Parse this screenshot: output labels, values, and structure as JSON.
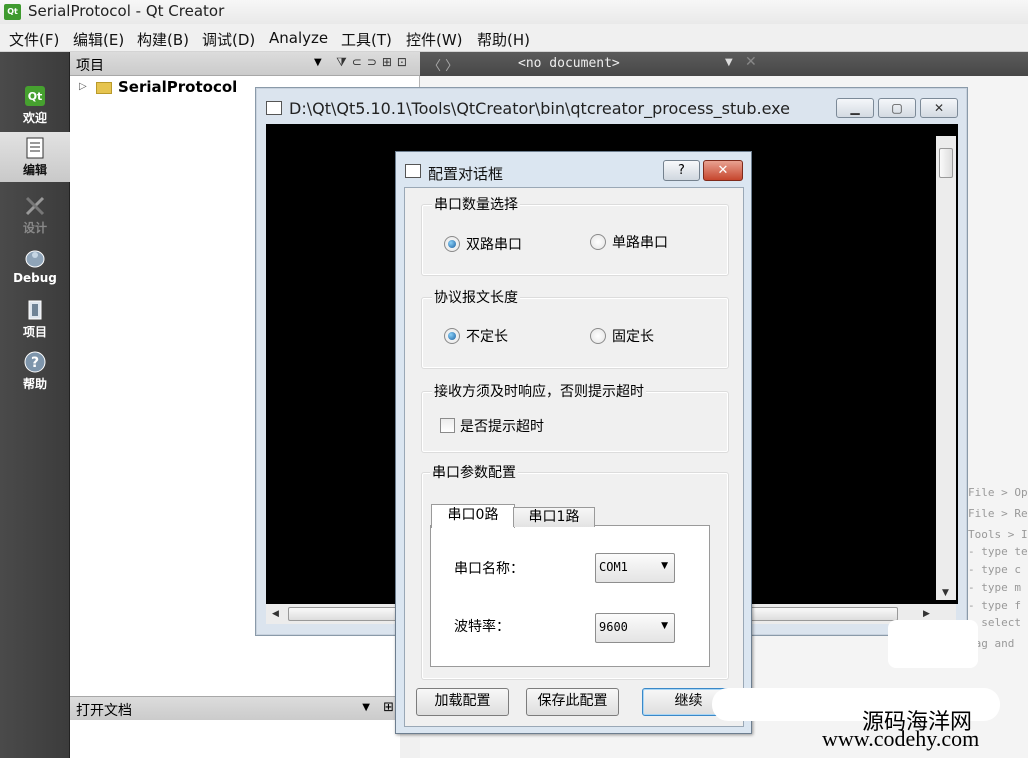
{
  "window": {
    "title": "SerialProtocol - Qt Creator",
    "logo_text": "Qt"
  },
  "menu": [
    "文件(F)",
    "编辑(E)",
    "构建(B)",
    "调试(D)",
    "Analyze",
    "工具(T)",
    "控件(W)",
    "帮助(H)"
  ],
  "modes": [
    {
      "label": "欢迎",
      "icon": "qt-logo-icon"
    },
    {
      "label": "编辑",
      "icon": "edit-document-icon"
    },
    {
      "label": "设计",
      "icon": "design-tools-icon"
    },
    {
      "label": "Debug",
      "icon": "debug-bug-icon"
    },
    {
      "label": "项目",
      "icon": "project-icon"
    },
    {
      "label": "帮助",
      "icon": "help-icon"
    }
  ],
  "projects": {
    "header": "项目",
    "tree_root": "SerialProtocol"
  },
  "open_docs": {
    "header": "打开文档"
  },
  "editor": {
    "doc_selector": "<no document>",
    "hints": [
      "File > Op",
      "File > Re",
      "Tools > I",
      "- type te",
      "- type c",
      "- type m",
      "- type f",
      "- select",
      "rag and"
    ]
  },
  "console": {
    "title": "D:\\Qt\\Qt5.10.1\\Tools\\QtCreator\\bin\\qtcreator_process_stub.exe"
  },
  "dialog": {
    "title": "配置对话框",
    "help_symbol": "?",
    "close_symbol": "✕",
    "group_count": {
      "title": "串口数量选择",
      "options": [
        {
          "label": "双路串口",
          "checked": true
        },
        {
          "label": "单路串口",
          "checked": false
        }
      ]
    },
    "group_length": {
      "title": "协议报文长度",
      "options": [
        {
          "label": "不定长",
          "checked": true
        },
        {
          "label": "固定长",
          "checked": false
        }
      ]
    },
    "group_timeout": {
      "title": "接收方须及时响应，否则提示超时",
      "checkbox": {
        "label": "是否提示超时",
        "checked": false
      }
    },
    "group_params": {
      "title": "串口参数配置",
      "tabs": [
        "串口0路",
        "串口1路"
      ],
      "active_tab": 0,
      "port_label": "串口名称：",
      "port_value": "COM1",
      "baud_label": "波特率：",
      "baud_value": "9600"
    },
    "buttons": {
      "load": "加载配置",
      "save": "保存此配置",
      "continue": "继续"
    }
  },
  "watermark": {
    "line1": "源码海洋网",
    "line2": "www.codehy.com"
  }
}
